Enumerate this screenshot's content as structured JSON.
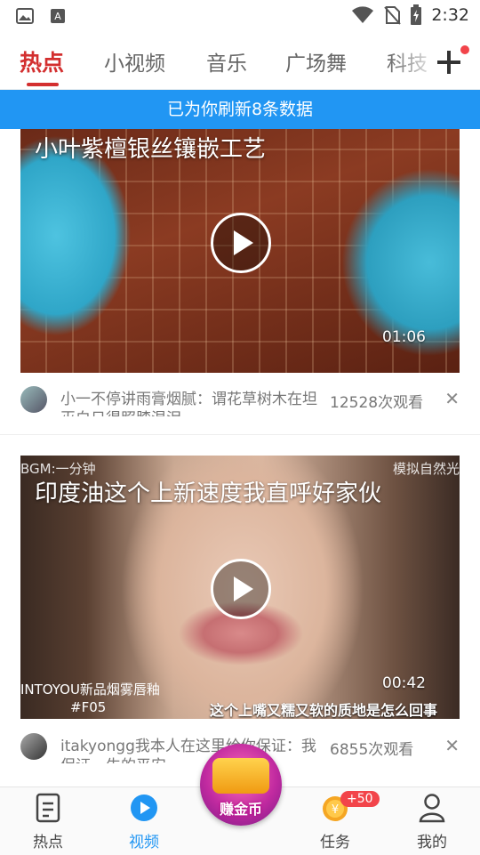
{
  "status_bar": {
    "time": "2:32",
    "left_icons": [
      "image-icon",
      "text-app-icon"
    ],
    "right_icons": [
      "wifi-icon",
      "no-sim-icon",
      "battery-charging-icon"
    ]
  },
  "top_tabs": {
    "items": [
      {
        "label": "热点",
        "active": true
      },
      {
        "label": "小视频",
        "active": false
      },
      {
        "label": "音乐",
        "active": false
      },
      {
        "label": "广场舞",
        "active": false
      },
      {
        "label": "科技",
        "active": false
      }
    ],
    "add_icon": "plus-icon"
  },
  "refresh_banner": "已为你刷新8条数据",
  "videos": [
    {
      "title": "小叶紫檀银丝镶嵌工艺",
      "duration": "01:06",
      "author_text": "小一不停讲雨膏烟腻：谓花草树木在坦灭白日得照膝混泪",
      "views": "12528次观看"
    },
    {
      "title": "印度油这个上新速度我直呼好家伙",
      "duration": "00:42",
      "overlay_top_left": "BGM:一分钟",
      "overlay_top_right": "模拟自然光",
      "overlay_bottom_left_1": "INTOYOU新品烟雾唇釉",
      "overlay_bottom_left_2": "#F05",
      "overlay_caption": "这个上嘴又糯又软的质地是怎么回事",
      "author_text": "itakyongg我本人在这里给你保证：我保证一生的平安",
      "views": "6855次观看"
    }
  ],
  "bottom_nav": {
    "items": [
      {
        "label": "热点",
        "icon": "news-icon",
        "active": false
      },
      {
        "label": "视频",
        "icon": "play-circle-icon",
        "active": true
      },
      {
        "label": "任务",
        "icon": "coin-icon",
        "active": false
      },
      {
        "label": "我的",
        "icon": "person-icon",
        "active": false
      }
    ],
    "task_badge": "+50",
    "center_button": "赚金币"
  },
  "colors": {
    "accent_red": "#d32f2f",
    "banner_blue": "#2196f3",
    "badge_red": "#f2444a"
  }
}
